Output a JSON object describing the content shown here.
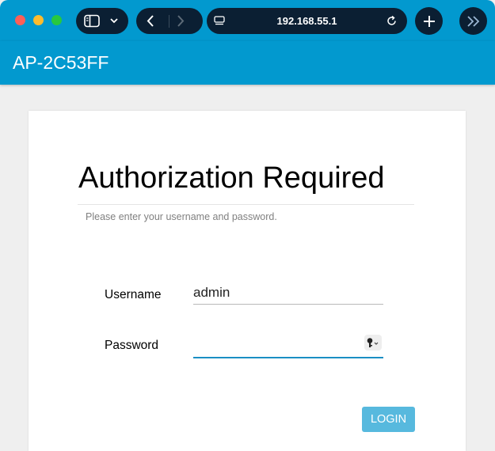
{
  "browser": {
    "address": "192.168.55.1",
    "icons": {
      "sidebar": "sidebar-icon",
      "chevron": "chevron-down-icon",
      "back": "back-icon",
      "forward": "forward-icon",
      "page": "page-icon",
      "reload": "reload-icon",
      "new_tab": "plus-icon",
      "more": "double-chevron-icon"
    }
  },
  "header": {
    "title": "AP-2C53FF"
  },
  "login": {
    "heading": "Authorization Required",
    "subtext": "Please enter your username and password.",
    "username_label": "Username",
    "username_value": "admin",
    "password_label": "Password",
    "password_value": "",
    "submit_label": "LOGIN"
  },
  "colors": {
    "accent": "#0299cf",
    "button": "#57b9de",
    "background": "#efefef"
  }
}
